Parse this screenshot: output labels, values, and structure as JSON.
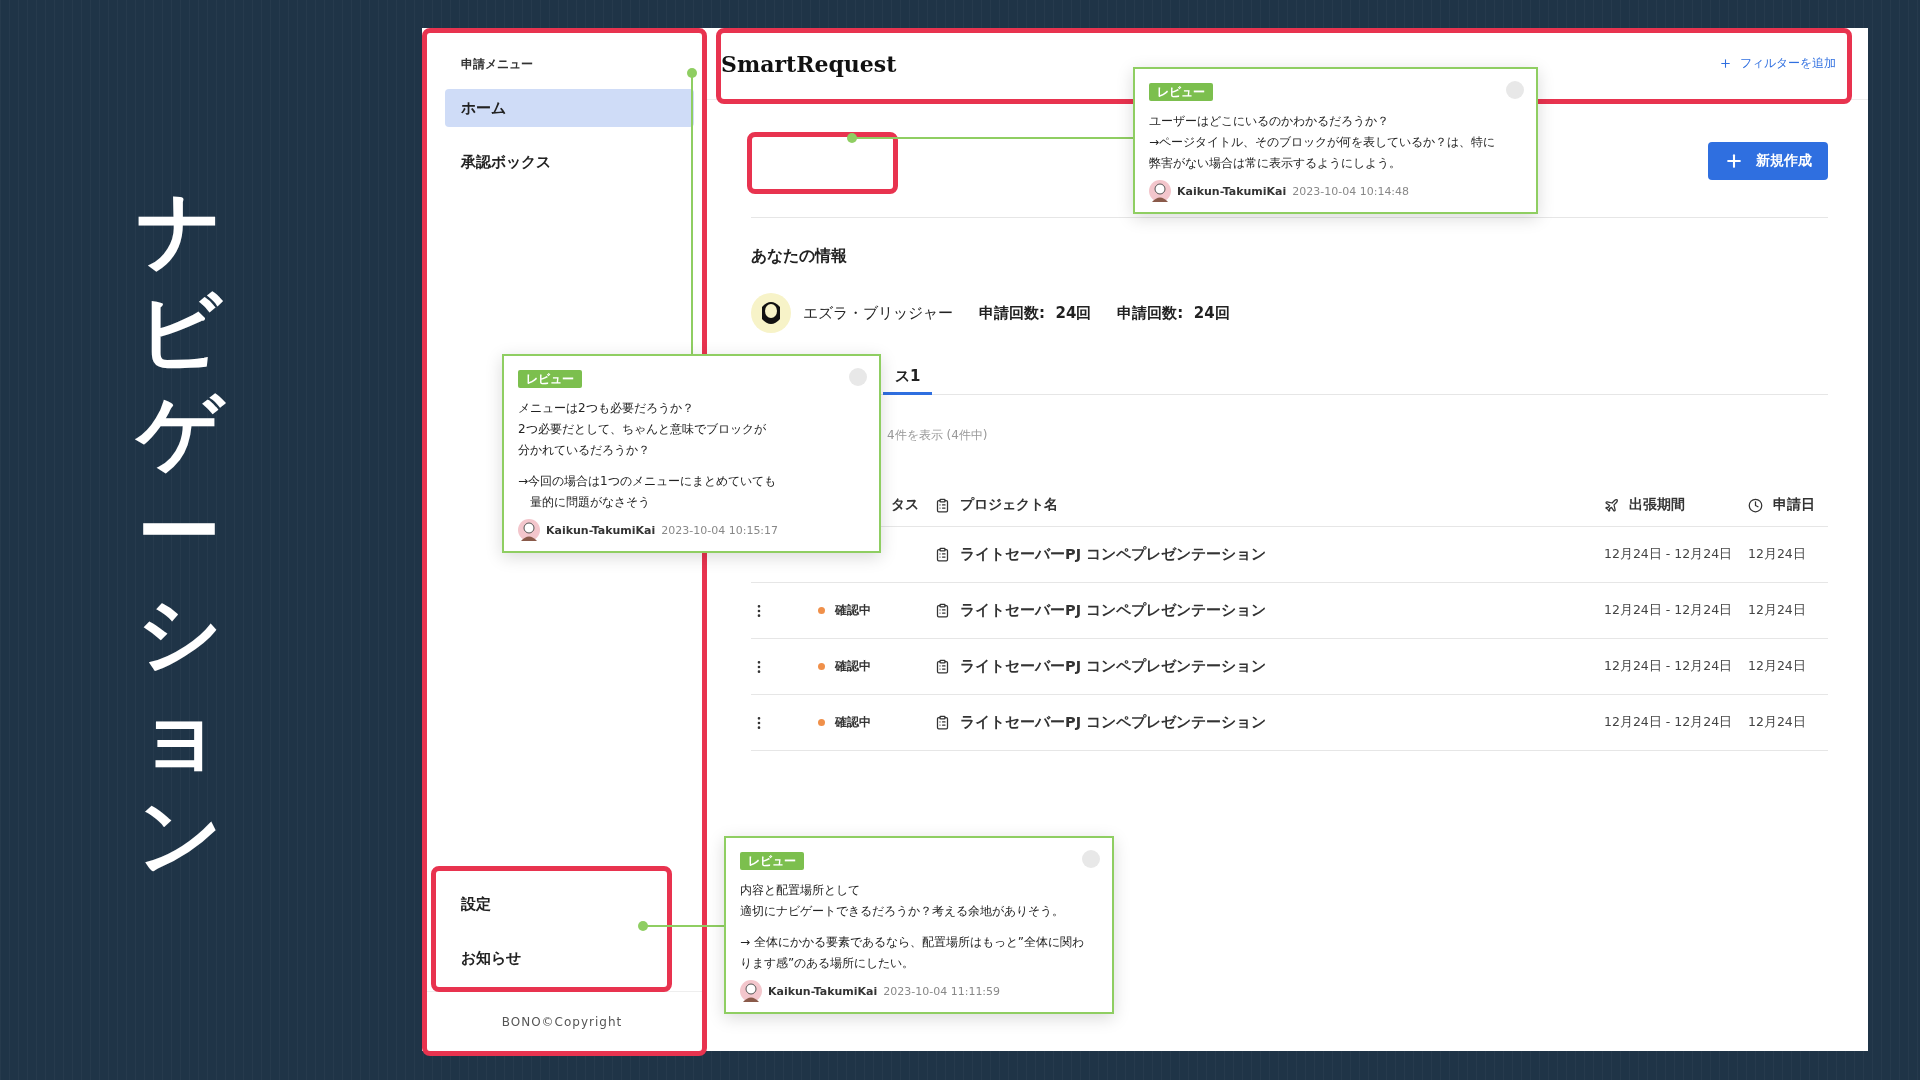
{
  "slide_title": "ナビゲーション",
  "sidebar": {
    "heading": "申請メニュー",
    "items": [
      {
        "label": "ホーム",
        "selected": true
      },
      {
        "label": "承認ボックス",
        "selected": false
      }
    ],
    "bottom_items": [
      "設定",
      "お知らせ"
    ],
    "footer": "BONO©Copyright"
  },
  "header": {
    "title": "SmartRequest",
    "filter_button": "フィルターを追加"
  },
  "new_button": "新規作成",
  "user_info": {
    "heading": "あなたの情報",
    "name": "エズラ・ブリッジャー",
    "stats": [
      "申請回数:  24回",
      "申請回数:  24回"
    ]
  },
  "tabs": [
    {
      "label": "ス1",
      "selected": true
    }
  ],
  "list_count": "4件を表示 (4件中)",
  "table": {
    "columns": [
      {
        "label": "タス"
      },
      {
        "label": "プロジェクト名"
      },
      {
        "label": "出張期間"
      },
      {
        "label": "申請日"
      }
    ],
    "rows": [
      {
        "project": "ライトセーバーPJ コンペプレゼンテーション",
        "period": "12月24日 - 12月24日",
        "date": "12月24日"
      },
      {
        "status": "確認中",
        "color": "#f0904a",
        "project": "ライトセーバーPJ コンペプレゼンテーション",
        "period": "12月24日 - 12月24日",
        "date": "12月24日"
      },
      {
        "status": "確認中",
        "color": "#f0904a",
        "project": "ライトセーバーPJ コンペプレゼンテーション",
        "period": "12月24日 - 12月24日",
        "date": "12月24日"
      },
      {
        "status": "確認中",
        "color": "#f0904a",
        "project": "ライトセーバーPJ コンペプレゼンテーション",
        "period": "12月24日 - 12月24日",
        "date": "12月24日"
      }
    ]
  },
  "comments": [
    {
      "tag": "レビュー",
      "paragraphs": [
        [
          "ユーザーはどこにいるのかわかるだろうか？",
          "→ページタイトル、そのブロックが何を表しているか？は、特に",
          "弊害がない場合は常に表示するようにしよう。"
        ]
      ],
      "author": "Kaikun-TakumiKai",
      "timestamp": "2023-10-04 10:14:48"
    },
    {
      "tag": "レビュー",
      "paragraphs": [
        [
          "メニューは2つも必要だろうか？",
          "2つ必要だとして、ちゃんと意味でブロックが",
          "分かれているだろうか？"
        ],
        [
          "→今回の場合は1つのメニューにまとめていても",
          "　量的に問題がなさそう"
        ]
      ],
      "author": "Kaikun-TakumiKai",
      "timestamp": "2023-10-04 10:15:17"
    },
    {
      "tag": "レビュー",
      "paragraphs": [
        [
          "内容と配置場所として",
          "適切にナビゲートできるだろうか？考える余地がありそう。"
        ],
        [
          "→ 全体にかかる要素であるなら、配置場所はもっと”全体に関わ",
          "ります感”のある場所にしたい。"
        ]
      ],
      "author": "Kaikun-TakumiKai",
      "timestamp": "2023-10-04 11:11:59"
    }
  ]
}
